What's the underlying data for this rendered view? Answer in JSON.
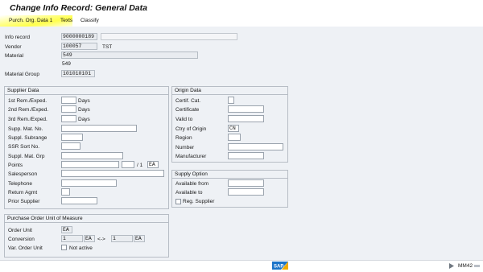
{
  "window": {
    "title": "Change Info Record: General Data"
  },
  "tabs": [
    "Purch. Org. Data 1",
    "Texts",
    "Classify"
  ],
  "header": {
    "info_record_label": "Info record",
    "info_record_value": "9000000189",
    "info_record_desc": "",
    "vendor_label": "Vendor",
    "vendor_value": "100057",
    "vendor_name": "TST",
    "material_label": "Material",
    "material_value": "549",
    "material_desc": "549",
    "material_group_label": "Material Group",
    "material_group_value": "101010101"
  },
  "supplier_data": {
    "title": "Supplier Data",
    "rem1_label": "1st Rem./Exped.",
    "rem2_label": "2nd Rem./Exped.",
    "rem3_label": "3rd Rem./Exped.",
    "days": "Days",
    "supp_mat_no_label": "Supp. Mat. No.",
    "suppl_subrange_label": "Suppl. Subrange",
    "ssr_sort_no_label": "SSR Sort No.",
    "suppl_mat_grp_label": "Suppl. Mat. Grp",
    "points_label": "Points",
    "points_sep": "/ 1",
    "points_unit": "EA",
    "salesperson_label": "Salesperson",
    "telephone_label": "Telephone",
    "return_agmt_label": "Return Agmt",
    "prior_supplier_label": "Prior Supplier"
  },
  "origin_data": {
    "title": "Origin Data",
    "certif_cat_label": "Certif. Cat.",
    "certificate_label": "Certificate",
    "valid_to_label": "Valid to",
    "ctry_origin_label": "Ctry of Origin",
    "ctry_origin_value": "CN",
    "region_label": "Region",
    "number_label": "Number",
    "manufacturer_label": "Manufacturer"
  },
  "supply_option": {
    "title": "Supply Option",
    "available_from_label": "Available from",
    "available_to_label": "Available to",
    "reg_supplier_label": "Reg. Supplier"
  },
  "po_unit": {
    "title": "Purchase Order Unit of Measure",
    "order_unit_label": "Order Unit",
    "order_unit_value": "EA",
    "conversion_label": "Conversion",
    "conv_left_qty": "1",
    "conv_left_unit": "EA",
    "conv_arrow": "<->",
    "conv_right_qty": "1",
    "conv_right_unit": "EA",
    "var_order_unit_label": "Var. Order Unit",
    "var_order_unit_value": "Not active"
  },
  "status": {
    "logo": "SAP",
    "transaction": "MM42"
  },
  "colors": {
    "highlight": "#ffff33",
    "sap_blue": "#1a73c8",
    "sap_gold": "#f0ab00"
  }
}
